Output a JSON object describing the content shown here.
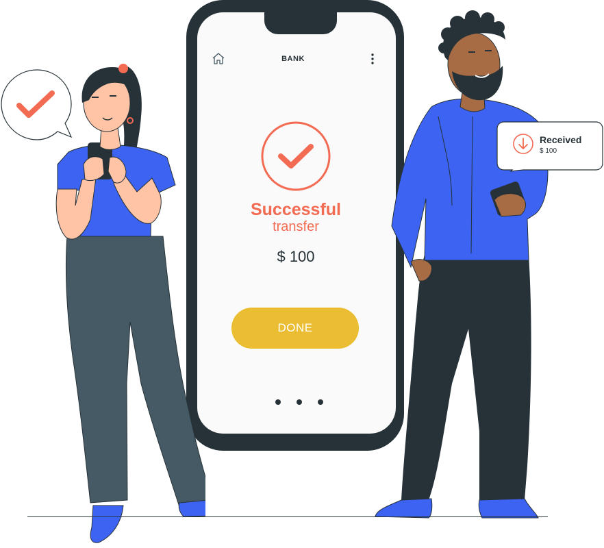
{
  "colors": {
    "accent": "#f26b52",
    "button": "#ebbd32",
    "dark": "#263238",
    "shirt_blue": "#3d63f2",
    "skin_light": "#ffc3a6",
    "skin_dark": "#a86c45",
    "pants_gray": "#455a64"
  },
  "phone": {
    "header": {
      "title": "BANK",
      "left_icon": "home-icon",
      "right_icon": "more-vertical-icon"
    },
    "status_icon": "check-circle-icon",
    "success_title": "Successful",
    "success_subtitle": "transfer",
    "amount": "$ 100",
    "done_label": "DONE",
    "pagination_dots": 3
  },
  "bubble_left": {
    "icon": "check-icon"
  },
  "received_card": {
    "icon": "arrow-down-circle-icon",
    "label": "Received",
    "amount": "$ 100"
  }
}
